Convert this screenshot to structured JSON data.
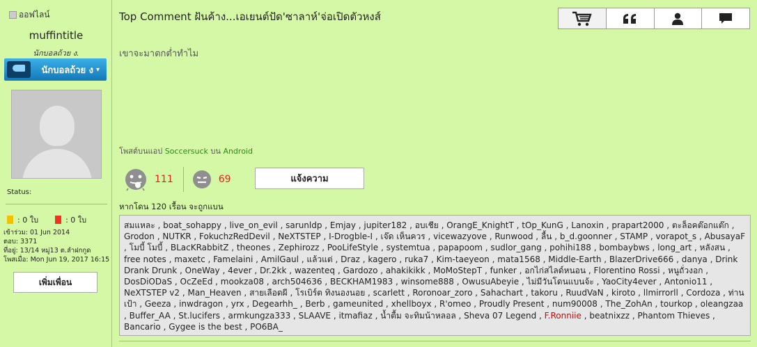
{
  "sidebar": {
    "status_text": "ออฟไลน์",
    "username": "muffintitle",
    "rank_title": "นักบอลถ้วย ง.",
    "rank_badge": "นักบอลถ้วย ง",
    "status_label": "Status:",
    "yellow_cards": ": 0 ใบ",
    "red_cards": ": 0 ใบ",
    "joined": "เข้าร่วม: 01 Jun 2014",
    "posts": "ตอบ: 3371",
    "address": "ที่อยู่: 13/14 หมู่13 ต.ลำฝกกูด",
    "last_post": "โพสเมื่อ: Mon Jun 19, 2017 16:15",
    "add_friend": "เพิ่มเพื่อน"
  },
  "post": {
    "title": "Top Comment ฝันค้าง...เอเยนต์ปัด'ซาลาห์'จ่อเปิดตัวหงส์",
    "body": "เขาจะมาตกต่ำทำไม",
    "posted_via_prefix": "โพสต์บนแอป",
    "posted_via_app": "Soccersuck",
    "posted_via_mid": "บน",
    "posted_via_platform": "Android",
    "likes": "111",
    "dislikes": "69",
    "report_label": "แจ้งความ",
    "banned_label": "หากโดน 120 เรื้อน จะถูกแบน",
    "banned_text_1": "สมแหละ , boat_sohappy , live_on_evil , sarunldp , Emjay , jupiter182 , อบเชีย , OrangE_KnightT , tOp_KunG , Lanoxin , prapart2000 , ตะล็อคต๊อกแต๊ก , Grodon , NUTKR , FokuchzRedDevil , NeXTSTEP , I-Drogble-I , เจ๊ด เห็นควร , vicewazyove , Runwood , ลื้น , b_d.goonner , STAMP , vorapot_s , AbusayaF , โมบี้ โมบี้ , BLacKRabbitZ , theones , Zephirozz , PooLifeStyle , systemtua , papapoom , sudlor_gang , pohihi188 , bombaybws , long_art , หลังสน , free notes , maxetc , Famelaini , AmilGaul , แล้วแต่ , Draz , kagero , ruka7 , Kim-taeyeon , mata1568 , Middle-Earth , BlazerDrive666 , danya , Drink Drank Drunk , OneWay , 4ever , Dr.2kk , wazenteq , Gardozo , ahakikikk , MoMoStepT , funker , อกไก่สไลด์หนอน , Florentino Rossi , หนูถั่วงอก , DosDiODaS , OcZeEd , mookza08 , arch504636 , BECKHAM1983 , winsome888 , OwusuAbeyie , ไม่มีวันโดนแบนจ้ะ , YaoCity4ever , Antonio11 , NeXTSTEP v2 , Man_Heaven , สายเลือดผี , โรเบิร์ต ทิงนองนอย , scarlett , Roronoar_zoro , Sahachart , takoru , RuudVaN , kiroto , llmirrorll , Cordoza , ท่านเป้า , Geeza , inwdragon , yrx , Degearhh_ , Berb , gameunited , xhellboyx , R'omeo , Proudly Present , num90008 , The_ZohAn , tourkop , oleangzaa , Buffer_AA , St.lucifers , armkungza333 , SLAAVE , itmafiaz , น้ำตื้ม จะทิมน้าหลอล , Sheva 07 Legend ,",
    "banned_highlight": "F.Ronniie",
    "banned_text_2": ", beatnixzz , Phantom Thieves , Bancario , Gygee is the best , PO6BA_"
  },
  "icons": {
    "toolbar": [
      "cart-icon",
      "quote-icon",
      "user-icon",
      "message-icon"
    ]
  },
  "colors": {
    "page_bg": "#d5f8a6",
    "like_count": "#e02020",
    "link_green": "#2a8a12",
    "badge_blue": "#1478b8"
  }
}
